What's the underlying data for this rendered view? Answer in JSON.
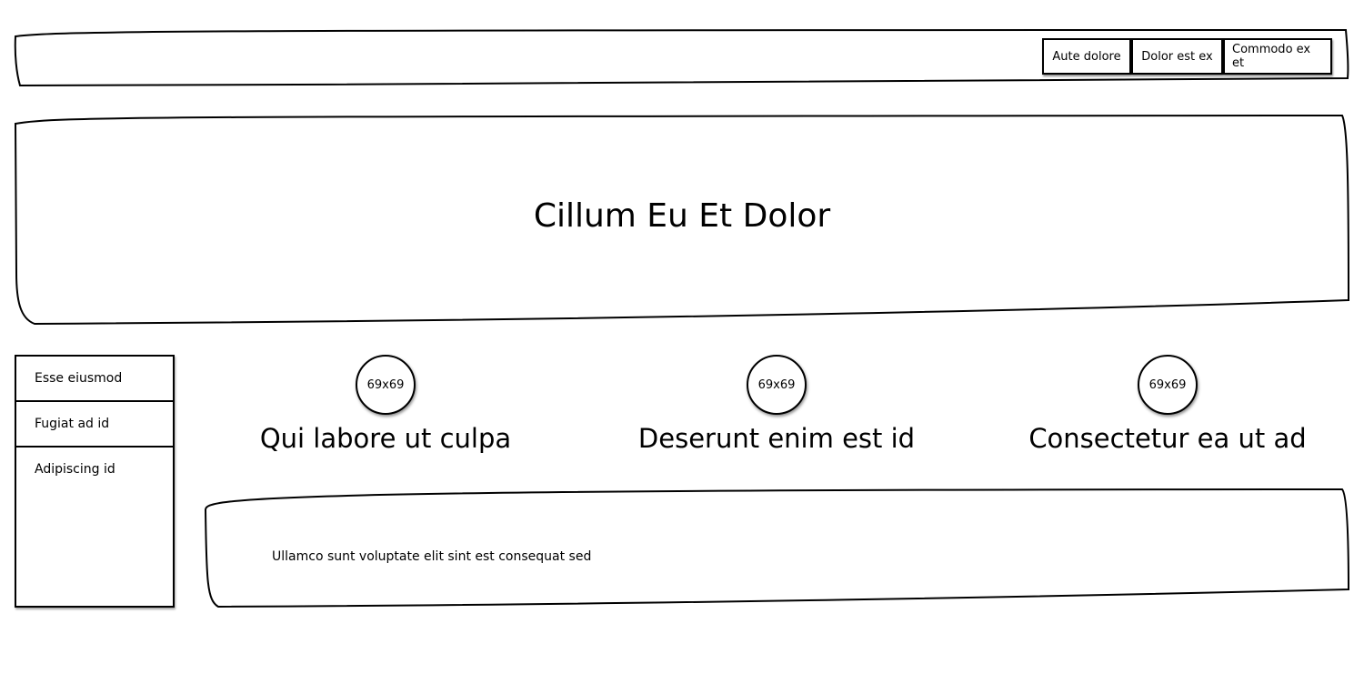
{
  "nav": {
    "items": [
      "Aute dolore",
      "Dolor est ex",
      "Commodo ex et"
    ]
  },
  "hero": {
    "title": "Cillum Eu Et Dolor"
  },
  "sidebar": {
    "items": [
      "Esse eiusmod",
      "Fugiat ad id",
      "Adipiscing id"
    ]
  },
  "features": [
    {
      "image_label": "69x69",
      "title": "Qui labore ut culpa"
    },
    {
      "image_label": "69x69",
      "title": "Deserunt enim est id"
    },
    {
      "image_label": "69x69",
      "title": "Consectetur ea ut ad"
    }
  ],
  "content": {
    "text": "Ullamco sunt voluptate elit sint est consequat sed"
  }
}
